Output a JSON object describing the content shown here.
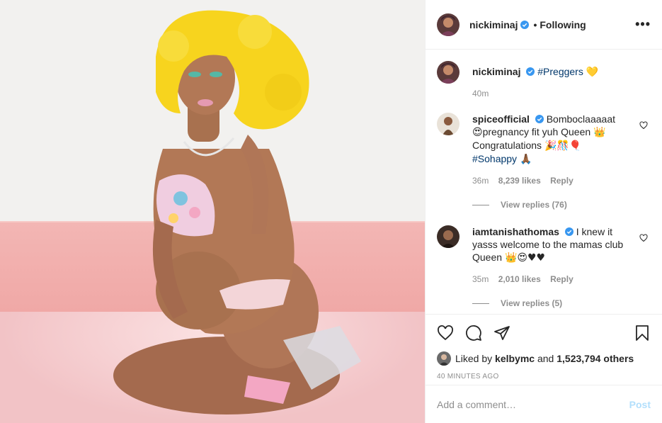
{
  "header": {
    "username": "nickiminaj",
    "separator": "•",
    "follow_status": "Following",
    "more_label": "•••"
  },
  "caption": {
    "username": "nickiminaj",
    "hashtag": "#Preggers",
    "emoji": "💛",
    "time": "40m"
  },
  "comments": [
    {
      "username": "spiceofficial",
      "text_parts": [
        "Bomboclaaaaat ",
        "😍",
        "pregnancy fit yuh Queen ",
        "👑",
        " Congratulations ",
        "🎉🎊🎈"
      ],
      "hashtag": "#Sohappy",
      "hashtag_emoji": "🙏🏾",
      "time": "36m",
      "likes": "8,239 likes",
      "reply_label": "Reply",
      "view_replies": "View replies (76)"
    },
    {
      "username": "iamtanishathomas",
      "text_parts": [
        "I knew it yasss welcome to the mamas club Queen ",
        "👑😍♥♥"
      ],
      "time": "35m",
      "likes": "2,010 likes",
      "reply_label": "Reply",
      "view_replies": "View replies (5)"
    }
  ],
  "actions": {
    "like_icon": "heart-icon",
    "comment_icon": "comment-icon",
    "share_icon": "share-icon",
    "save_icon": "bookmark-icon"
  },
  "likes": {
    "prefix": "Liked by ",
    "user": "kelbymc",
    "middle": " and ",
    "others": "1,523,794 others"
  },
  "timestamp": "40 MINUTES AGO",
  "add_comment": {
    "placeholder": "Add a comment…",
    "post_label": "Post"
  },
  "colors": {
    "verified": "#3897f0",
    "link": "#00376b",
    "muted": "#8e8e8e",
    "post_disabled": "#b2dffc",
    "wig": "#f7d41e",
    "couch": "#f1aeb0"
  }
}
